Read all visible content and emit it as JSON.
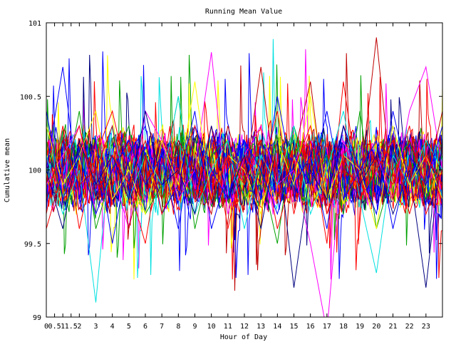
{
  "chart_data": {
    "type": "line",
    "title": "Running Mean Value",
    "xlabel": "Hour of Day",
    "ylabel": "Cumulative mean",
    "xlim": [
      0,
      24
    ],
    "ylim": [
      99,
      101
    ],
    "x_ticks": [
      0,
      0.5,
      1,
      1.5,
      2,
      3,
      4,
      5,
      6,
      7,
      8,
      9,
      10,
      11,
      12,
      13,
      14,
      15,
      16,
      17,
      18,
      19,
      20,
      21,
      22,
      23
    ],
    "x_tick_labels": [
      "0",
      "0.5",
      "1",
      "1.5",
      "2",
      "3",
      "4",
      "5",
      "6",
      "7",
      "8",
      "9",
      "10",
      "11",
      "12",
      "13",
      "14",
      "15",
      "16",
      "17",
      "18",
      "19",
      "20",
      "21",
      "22",
      "23"
    ],
    "y_ticks": [
      99,
      99.5,
      100,
      100.5,
      101
    ],
    "y_tick_labels": [
      "99",
      "99.5",
      "100",
      "100.5",
      "101"
    ],
    "grid": false,
    "legend": "none",
    "center_value": 100,
    "typical_spread": 0.28,
    "series_colors": [
      "#ff0000",
      "#00a000",
      "#0000ff",
      "#ff00ff",
      "#00e0e0",
      "#ffff00",
      "#c00000",
      "#000080",
      "#0000ff",
      "#ff0000"
    ],
    "series": [
      {
        "values": [
          99.7,
          100.3,
          99.6,
          100.1,
          100.4,
          99.9,
          99.5,
          100.2,
          100.0,
          99.8,
          100.3,
          99.6,
          100.1,
          99.9,
          100.4,
          99.7,
          100.2,
          99.5,
          100.6,
          99.8,
          100.1,
          99.9,
          100.3,
          99.7,
          100.0
        ]
      },
      {
        "values": [
          100.2,
          99.8,
          100.4,
          99.6,
          100.0,
          100.3,
          99.7,
          99.9,
          100.5,
          99.6,
          100.1,
          100.2,
          99.8,
          100.0,
          99.5,
          100.3,
          99.9,
          100.1,
          99.7,
          100.4,
          99.6,
          100.0,
          100.2,
          99.8,
          100.1
        ]
      },
      {
        "values": [
          100.0,
          100.7,
          99.8,
          100.2,
          99.5,
          100.1,
          100.3,
          99.7,
          99.9,
          100.4,
          99.6,
          100.0,
          100.2,
          99.8,
          100.5,
          99.9,
          100.1,
          99.6,
          100.3,
          100.0,
          99.7,
          100.4,
          99.9,
          100.1,
          99.8
        ]
      },
      {
        "values": [
          99.9,
          100.1,
          100.3,
          99.7,
          100.0,
          99.6,
          100.4,
          100.2,
          99.8,
          100.0,
          100.8,
          99.7,
          100.1,
          100.3,
          99.9,
          100.0,
          99.5,
          98.9,
          100.2,
          99.9,
          100.1,
          99.8,
          100.4,
          100.7,
          100.0
        ]
      },
      {
        "values": [
          100.1,
          99.7,
          100.0,
          99.1,
          100.3,
          99.8,
          100.1,
          99.9,
          100.5,
          99.7,
          100.0,
          100.2,
          99.6,
          100.1,
          99.9,
          100.3,
          99.7,
          100.0,
          100.4,
          99.8,
          99.3,
          100.1,
          99.9,
          100.2,
          100.0
        ]
      },
      {
        "values": [
          100.3,
          99.9,
          100.1,
          100.4,
          99.8,
          100.0,
          99.7,
          100.2,
          99.9,
          100.6,
          99.8,
          100.1,
          100.0,
          99.7,
          100.2,
          99.9,
          100.5,
          99.8,
          100.1,
          100.0,
          99.6,
          100.3,
          99.9,
          100.1,
          99.8
        ]
      },
      {
        "values": [
          99.8,
          100.2,
          99.9,
          100.0,
          100.3,
          99.6,
          100.1,
          99.8,
          100.2,
          100.0,
          99.7,
          100.3,
          99.9,
          100.7,
          99.8,
          100.1,
          100.6,
          99.7,
          100.0,
          99.9,
          100.9,
          99.8,
          100.2,
          99.9,
          100.4
        ]
      },
      {
        "values": [
          100.0,
          99.6,
          100.2,
          99.9,
          100.1,
          99.8,
          100.4,
          99.9,
          100.0,
          99.7,
          100.3,
          99.8,
          100.1,
          99.6,
          100.2,
          99.2,
          100.0,
          99.8,
          100.3,
          99.9,
          100.1,
          99.7,
          100.0,
          99.2,
          100.2
        ]
      },
      {
        "values": [
          100.4,
          99.8,
          100.1,
          99.7,
          100.0,
          100.2,
          99.9,
          100.1,
          99.6,
          100.3,
          100.0,
          99.8,
          100.2,
          100.0,
          99.7,
          100.1,
          99.9,
          100.4,
          99.8,
          100.0,
          100.2,
          99.6,
          100.1,
          99.9,
          100.3
        ]
      },
      {
        "values": [
          99.6,
          100.0,
          100.3,
          99.8,
          100.1,
          99.9,
          100.2,
          99.7,
          100.0,
          100.3,
          99.8,
          100.1,
          99.9,
          100.2,
          99.6,
          100.0,
          100.3,
          99.7,
          100.1,
          99.8,
          100.0,
          100.2,
          99.7,
          100.1,
          99.9
        ]
      }
    ]
  }
}
